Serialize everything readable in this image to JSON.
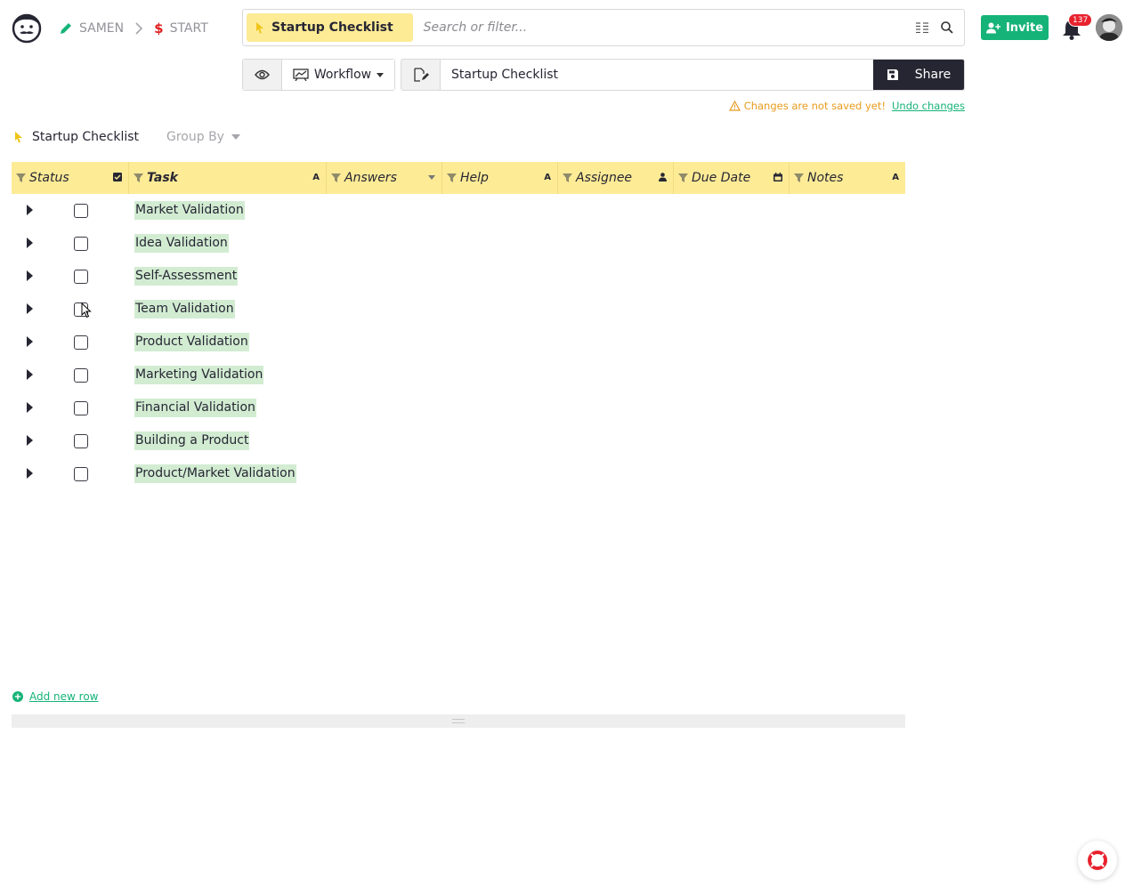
{
  "breadcrumb": {
    "org": "SAMEN",
    "doc": "START"
  },
  "search": {
    "page_pill": "Startup Checklist",
    "placeholder": "Search or filter..."
  },
  "header": {
    "invite_label": "Invite",
    "notification_count": "137"
  },
  "toolbar": {
    "view_type": "Workflow",
    "page_name": "Startup Checklist",
    "share_label": "Share"
  },
  "status": {
    "unsaved_text": "Changes are not saved yet!",
    "undo_label": "Undo changes"
  },
  "section": {
    "title": "Startup Checklist",
    "group_by_label": "Group By"
  },
  "columns": [
    {
      "label": "Status",
      "type_icon": "checkbox-icon"
    },
    {
      "label": "Task",
      "type_icon": "text-icon"
    },
    {
      "label": "Answers",
      "type_icon": "dropdown-icon"
    },
    {
      "label": "Help",
      "type_icon": "text-icon"
    },
    {
      "label": "Assignee",
      "type_icon": "person-icon"
    },
    {
      "label": "Due Date",
      "type_icon": "calendar-icon"
    },
    {
      "label": "Notes",
      "type_icon": "text-icon"
    }
  ],
  "rows": [
    {
      "task": "Market Validation",
      "checked": false
    },
    {
      "task": "Idea Validation",
      "checked": false
    },
    {
      "task": "Self-Assessment",
      "checked": false
    },
    {
      "task": "Team Validation",
      "checked": false
    },
    {
      "task": "Product Validation",
      "checked": false
    },
    {
      "task": "Marketing Validation",
      "checked": false
    },
    {
      "task": "Financial Validation",
      "checked": false
    },
    {
      "task": "Building a Product",
      "checked": false
    },
    {
      "task": "Product/Market Validation",
      "checked": false
    }
  ],
  "footer": {
    "add_row_label": "Add new row"
  },
  "colors": {
    "accent_green": "#16b378",
    "header_yellow": "#fdeb96",
    "task_highlight": "#d2ecd2",
    "dark": "#262633",
    "warning": "#e89b1d",
    "danger": "#e8222d"
  }
}
